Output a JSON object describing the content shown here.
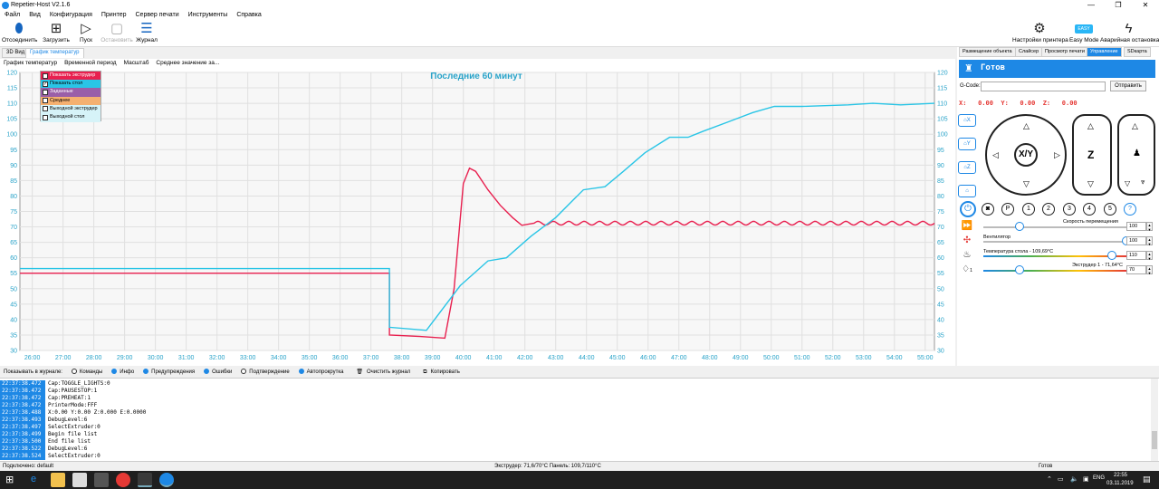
{
  "window": {
    "title": "Repetier-Host V2.1.6",
    "minimize": "—",
    "maximize": "❐",
    "close": "✕"
  },
  "menu": [
    "Файл",
    "Вид",
    "Конфигурация",
    "Принтер",
    "Сервер печати",
    "Инструменты",
    "Справка"
  ],
  "toolbar": {
    "disconnect": "Отсоединить",
    "load": "Загрузить",
    "start": "Пуск",
    "stop": "Остановить",
    "log": "Журнал",
    "printer_settings": "Настройки принтера",
    "easy_mode": "Easy Mode",
    "easy_badge": "EASY",
    "emergency_stop": "Аварийная остановка"
  },
  "left_tabs": [
    "3D Вид",
    "График температур"
  ],
  "graph_menu": [
    "График температур",
    "Временной период",
    "Масштаб",
    "Среднее значение за..."
  ],
  "chart_data": {
    "type": "line",
    "title": "Последние 60 минут",
    "x": [
      "26:00",
      "27:00",
      "28:00",
      "29:00",
      "30:00",
      "31:00",
      "32:00",
      "33:00",
      "34:00",
      "35:00",
      "36:00",
      "37:00",
      "38:00",
      "39:00",
      "40:00",
      "41:00",
      "42:00",
      "43:00",
      "44:00",
      "45:00",
      "46:00",
      "47:00",
      "48:00",
      "49:00",
      "50:00",
      "51:00",
      "52:00",
      "53:00",
      "54:00",
      "55:00"
    ],
    "ylim": [
      30,
      120
    ],
    "yticks": [
      30,
      35,
      40,
      45,
      50,
      55,
      60,
      65,
      70,
      75,
      80,
      85,
      90,
      95,
      100,
      105,
      110,
      115,
      120
    ],
    "grid": true,
    "legend_position": "top-left",
    "series": [
      {
        "name": "Показать экструдер",
        "color": "#e8204f",
        "points": [
          [
            25.6,
            55
          ],
          [
            37.6,
            55
          ],
          [
            37.6,
            35
          ],
          [
            38.6,
            34.5
          ],
          [
            39.4,
            34
          ],
          [
            39.7,
            50
          ],
          [
            40.0,
            84
          ],
          [
            40.2,
            89
          ],
          [
            40.4,
            88
          ],
          [
            40.8,
            82
          ],
          [
            41.2,
            77
          ],
          [
            41.6,
            73
          ],
          [
            41.9,
            70.5
          ],
          [
            42.3,
            71.2
          ],
          [
            55.3,
            71.2
          ]
        ]
      },
      {
        "name": "Показать стол",
        "color": "#29c5e6",
        "points": [
          [
            25.6,
            56.5
          ],
          [
            37.6,
            56.5
          ],
          [
            37.6,
            37.5
          ],
          [
            38.8,
            36.5
          ],
          [
            39.9,
            51
          ],
          [
            40.8,
            59
          ],
          [
            41.4,
            60
          ],
          [
            42.2,
            67
          ],
          [
            43.0,
            73
          ],
          [
            43.9,
            82
          ],
          [
            44.6,
            83
          ],
          [
            45.2,
            88
          ],
          [
            45.9,
            94
          ],
          [
            46.7,
            99
          ],
          [
            47.3,
            99
          ],
          [
            47.8,
            101
          ],
          [
            48.6,
            104
          ],
          [
            49.4,
            107
          ],
          [
            50.1,
            109
          ],
          [
            51.0,
            109
          ],
          [
            52.5,
            109.5
          ],
          [
            53.3,
            110
          ],
          [
            54.2,
            109.5
          ],
          [
            55.3,
            110
          ]
        ]
      }
    ],
    "legend_items": [
      {
        "label": "Показать экструдер",
        "checked": true,
        "color": "#e8204f"
      },
      {
        "label": "Показать стол",
        "checked": true,
        "color": "#29c5e6"
      },
      {
        "label": "Заданные",
        "checked": false,
        "color": "#9a5fa8"
      },
      {
        "label": "Среднее",
        "checked": false,
        "color": "#f5b070"
      },
      {
        "label": "Выходной экструдер",
        "checked": false,
        "color": "#d6f3f8"
      },
      {
        "label": "Выходной стол",
        "checked": false,
        "color": "#d6f3f8"
      }
    ]
  },
  "right_tabs": [
    "Размещение объекта",
    "Слайсер",
    "Просмотр печати",
    "Управление",
    "SDкарта"
  ],
  "control": {
    "status": "Готов",
    "gcode_label": "G-Code:",
    "gcode_value": "",
    "send": "Отправить",
    "coords": "X:   0.00  Y:   0.00  Z:   0.00",
    "home_x": "X",
    "home_y": "Y",
    "home_z": "Z",
    "xy_label": "X/Y",
    "z_label": "Z",
    "circle_buttons": [
      "P",
      "1",
      "2",
      "3",
      "4",
      "5",
      "?"
    ],
    "speed_label": "Скорость перемещения",
    "speed_value": "100",
    "speed_level": 0.25,
    "fan_label": "Вентилятор",
    "fan_value": "100",
    "fan_level": 1.0,
    "bed_label": "Температура стола - 109,69°C",
    "bed_value": "110",
    "bed_level": 0.9,
    "ext_label": "Экструдер 1 - 71,64°C",
    "ext_value": "70",
    "ext_level": 0.25,
    "ext_index": "1"
  },
  "log_bar": {
    "show_in_log": "Показывать в журнале:",
    "commands": "Команды",
    "info": "Инфо",
    "warnings": "Предупреждения",
    "errors": "Ошибки",
    "ack": "Подтверждение",
    "autoscroll": "Автопрокрутка",
    "clear": "Очистить журнал",
    "copy": "Копировать"
  },
  "log_rows": [
    {
      "time": "22:37:38.472",
      "text": "Cap:TOGGLE_LIGHTS:0"
    },
    {
      "time": "22:37:38.472",
      "text": "Cap:PAUSESTOP:1"
    },
    {
      "time": "22:37:38.472",
      "text": "Cap:PREHEAT:1"
    },
    {
      "time": "22:37:38.472",
      "text": "PrinterMode:FFF"
    },
    {
      "time": "22:37:38.488",
      "text": "X:0.00 Y:0.00 Z:0.000 E:0.0000"
    },
    {
      "time": "22:37:38.493",
      "text": "DebugLevel:6"
    },
    {
      "time": "22:37:38.497",
      "text": "SelectExtruder:0"
    },
    {
      "time": "22:37:38.499",
      "text": "Begin file list"
    },
    {
      "time": "22:37:38.500",
      "text": "End file list"
    },
    {
      "time": "22:37:38.522",
      "text": "DebugLevel:6"
    },
    {
      "time": "22:37:38.524",
      "text": "SelectExtruder:0"
    }
  ],
  "status_bar": {
    "connection": "Подключено: default",
    "temps": "Экструдер: 71,6/70°C Панель: 109,7/110°C",
    "state": "Готов"
  },
  "taskbar": {
    "lang": "ENG",
    "time": "22:55",
    "date": "03.11.2019"
  }
}
